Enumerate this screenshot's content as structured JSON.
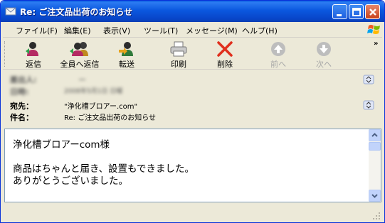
{
  "window": {
    "title": "Re: ご注文品出荷のお知らせ"
  },
  "menu": {
    "items": [
      "ファイル(F)",
      "編集(E)",
      "表示(V)",
      "ツール(T)",
      "メッセージ(M)",
      "ヘルプ(H)"
    ]
  },
  "toolbar": {
    "reply": "返信",
    "reply_all": "全員へ返信",
    "forward": "転送",
    "print": "印刷",
    "delete": "削除",
    "prev": "前へ",
    "next": "次へ",
    "more": "»"
  },
  "headers": {
    "from_label": "差出人:",
    "from_value": "ー",
    "date_label": "日時:",
    "date_value": "2008年5月1日 日曜",
    "to_label": "宛先：",
    "to_value": "\"浄化槽ブロアー.com\"",
    "subject_label": "件名：",
    "subject_value": "Re: ご注文品出荷のお知らせ"
  },
  "body": {
    "line1": "浄化槽ブロアーcom様",
    "line2": "商品はちゃんと届き、設置もできました。",
    "line3": "ありがとうございました。"
  },
  "colors": {
    "titlebar": "#0b58df",
    "frame": "#ece9d8",
    "close_button": "#c8421c",
    "delete_icon": "#e0301e"
  }
}
